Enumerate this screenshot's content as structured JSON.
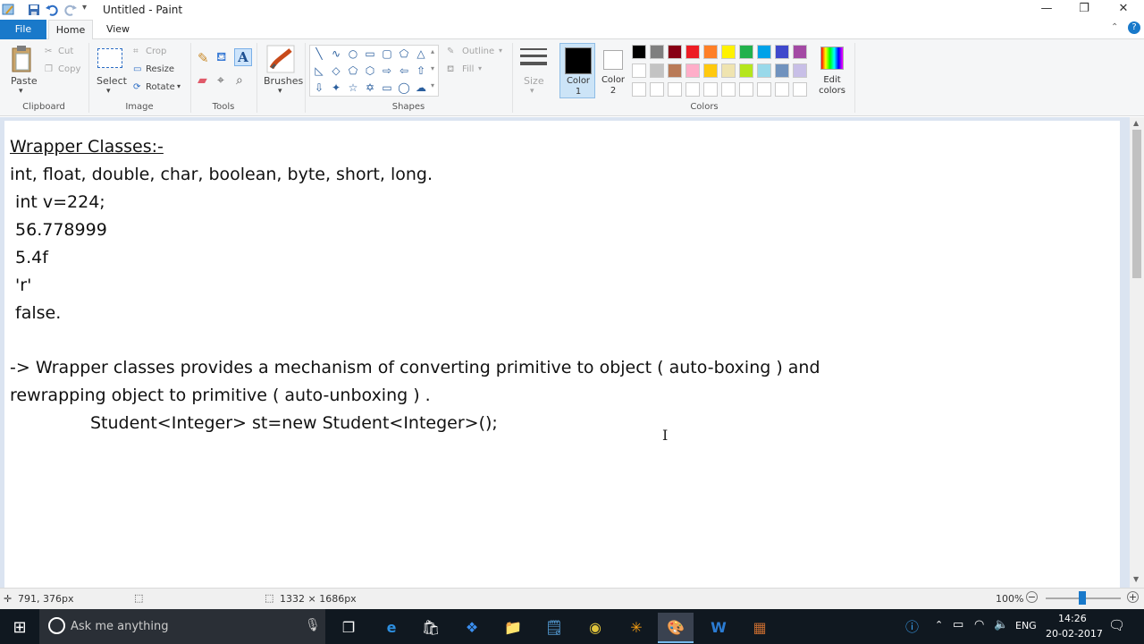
{
  "window": {
    "title": "Untitled - Paint",
    "minimize": "—",
    "restore": "❐",
    "close": "✕"
  },
  "tabs": {
    "file": "File",
    "home": "Home",
    "view": "View"
  },
  "ribbon": {
    "clipboard": {
      "paste": "Paste",
      "cut": "Cut",
      "copy": "Copy",
      "label": "Clipboard"
    },
    "image": {
      "select": "Select",
      "crop": "Crop",
      "resize": "Resize",
      "rotate": "Rotate",
      "label": "Image"
    },
    "tools": {
      "label": "Tools"
    },
    "brushes": {
      "label": "Brushes"
    },
    "shapes": {
      "outline": "Outline",
      "fill": "Fill",
      "label": "Shapes"
    },
    "size": {
      "label": "Size"
    },
    "color1": {
      "line1": "Color",
      "line2": "1"
    },
    "color2": {
      "line1": "Color",
      "line2": "2"
    },
    "edit_colors": {
      "line1": "Edit",
      "line2": "colors"
    },
    "colors_label": "Colors",
    "palette_row1": [
      "#000000",
      "#7f7f7f",
      "#880015",
      "#ed1c24",
      "#ff7f27",
      "#fff200",
      "#22b14c",
      "#00a2e8",
      "#3f48cc",
      "#a349a4"
    ],
    "palette_row2": [
      "#ffffff",
      "#c3c3c3",
      "#b97a57",
      "#ffaec9",
      "#ffc90e",
      "#efe4b0",
      "#b5e61d",
      "#99d9ea",
      "#7092be",
      "#c8bfe7"
    ],
    "color1_value": "#000000",
    "color2_value": "#ffffff"
  },
  "canvas": {
    "heading": "Wrapper Classes:-",
    "lines": [
      "int, float, double, char, boolean, byte, short, long.",
      " int v=224;",
      " 56.778999",
      " 5.4f",
      " 'r'",
      " false.",
      "-> Wrapper classes provides a mechanism of converting primitive to object ( auto-boxing ) and",
      "rewrapping object to primitive ( auto-unboxing ) .",
      "Student<Integer> st=new Student<Integer>();"
    ]
  },
  "status": {
    "cursor_pos": "791, 376px",
    "image_size": "1332 × 1686px",
    "zoom": "100%"
  },
  "taskbar": {
    "search_placeholder": "Ask me anything",
    "lang": "ENG",
    "time": "14:26",
    "date": "20-02-2017"
  }
}
